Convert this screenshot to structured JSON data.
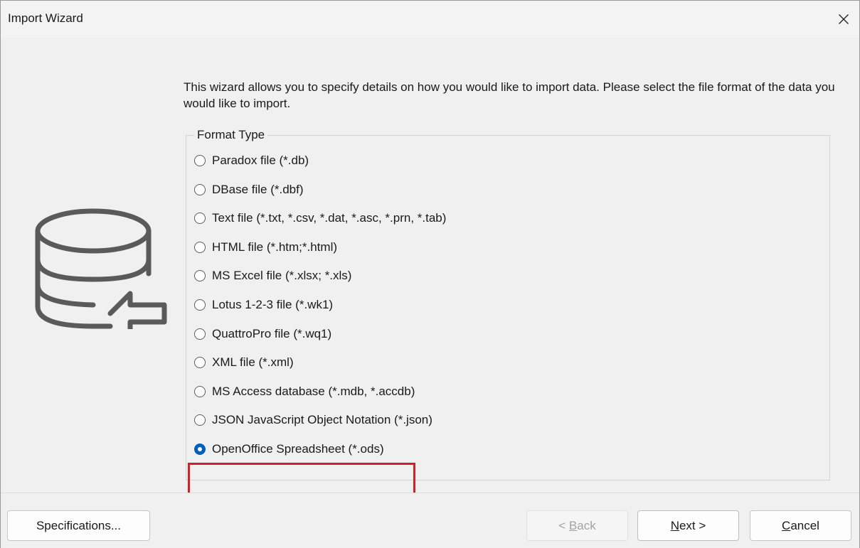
{
  "window": {
    "title": "Import Wizard"
  },
  "intro_text": "This wizard allows you to specify details on how you would like to import data. Please select the file format of the data you would like to import.",
  "format_group": {
    "legend": "Format Type",
    "selected_index": 10,
    "options": [
      "Paradox file (*.db)",
      "DBase file (*.dbf)",
      "Text file (*.txt, *.csv, *.dat, *.asc, *.prn, *.tab)",
      "HTML file (*.htm;*.html)",
      "MS Excel file (*.xlsx; *.xls)",
      "Lotus 1-2-3 file (*.wk1)",
      "QuattroPro file (*.wq1)",
      "XML file (*.xml)",
      "MS Access database (*.mdb, *.accdb)",
      "JSON JavaScript Object Notation (*.json)",
      "OpenOffice Spreadsheet (*.ods)"
    ]
  },
  "buttons": {
    "specifications": "Specifications...",
    "back_prefix": "< ",
    "back_key": "B",
    "back_rest": "ack",
    "next_key": "N",
    "next_rest": "ext >",
    "cancel_key": "C",
    "cancel_rest": "ancel"
  },
  "colors": {
    "accent": "#005fb8",
    "highlight_border": "#d0202a",
    "window_bg": "#f0f0f0"
  },
  "icons": {
    "close": "close-icon",
    "illustration": "database-import-icon"
  }
}
